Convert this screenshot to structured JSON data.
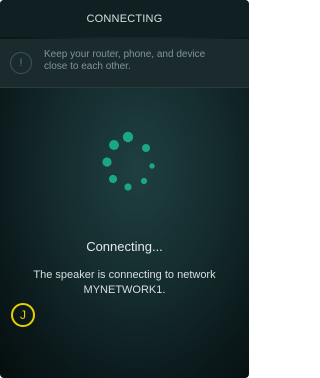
{
  "header": {
    "title": "CONNECTING"
  },
  "tip": {
    "icon": "info-circle-icon",
    "line1": "Keep your router, phone, and device",
    "line2": "close to each other."
  },
  "spinner": {
    "icon": "loading-spinner-icon",
    "color": "#19a882"
  },
  "status": {
    "label": "Connecting..."
  },
  "message": {
    "line1": "The speaker is connecting to network",
    "line2": "MYNETWORK1."
  },
  "marker": {
    "label": "J",
    "color": "#e8d000"
  }
}
